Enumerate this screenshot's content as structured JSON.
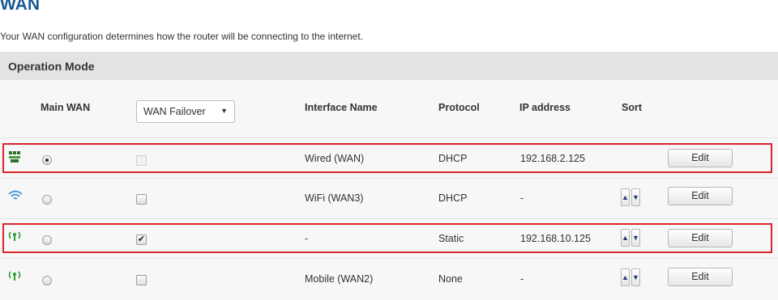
{
  "page": {
    "title": "WAN",
    "description": "Your WAN configuration determines how the router will be connecting to the internet."
  },
  "section": {
    "title": "Operation Mode"
  },
  "table": {
    "headers": {
      "main_wan": "Main WAN",
      "interface_name": "Interface Name",
      "protocol": "Protocol",
      "ip_address": "IP address",
      "sort": "Sort"
    },
    "mode_select": {
      "value": "WAN Failover"
    },
    "edit_label": "Edit",
    "rows": [
      {
        "icon": "ethernet-icon",
        "main_wan": true,
        "failover_checked": false,
        "failover_enabled": false,
        "interface": "Wired (WAN)",
        "protocol": "DHCP",
        "ip": "192.168.2.125",
        "sortable": false,
        "highlighted": true
      },
      {
        "icon": "wifi-icon",
        "main_wan": false,
        "failover_checked": false,
        "failover_enabled": true,
        "interface": "WiFi (WAN3)",
        "protocol": "DHCP",
        "ip": "-",
        "sortable": true,
        "highlighted": false
      },
      {
        "icon": "mobile-antenna-icon",
        "main_wan": false,
        "failover_checked": true,
        "failover_enabled": true,
        "interface": "-",
        "protocol": "Static",
        "ip": "192.168.10.125",
        "sortable": true,
        "highlighted": true
      },
      {
        "icon": "mobile-antenna-icon",
        "main_wan": false,
        "failover_checked": false,
        "failover_enabled": true,
        "interface": "Mobile (WAN2)",
        "protocol": "None",
        "ip": "-",
        "sortable": true,
        "highlighted": false
      }
    ]
  },
  "colors": {
    "title": "#1c5a94",
    "highlight_border": "#d9252a",
    "section_bg": "#e3e3e3",
    "table_bg": "#f7f7f7",
    "wifi_icon": "#3a8fd8",
    "mobile_icon": "#2f9a2f"
  }
}
